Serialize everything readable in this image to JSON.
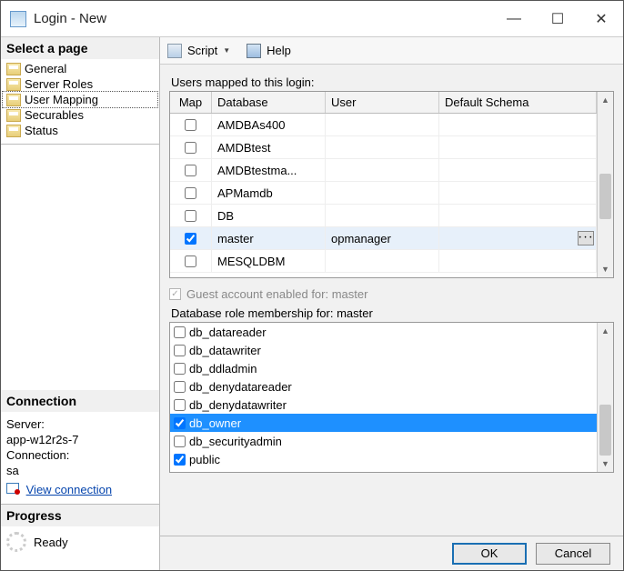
{
  "window": {
    "title": "Login - New"
  },
  "sidebar": {
    "heading": "Select a page",
    "pages": [
      "General",
      "Server Roles",
      "User Mapping",
      "Securables",
      "Status"
    ],
    "selected_index": 2
  },
  "connection": {
    "heading": "Connection",
    "server_label": "Server:",
    "server_value": "app-w12r2s-7",
    "conn_label": "Connection:",
    "conn_value": "sa",
    "view_link": "View connection"
  },
  "progress": {
    "heading": "Progress",
    "status": "Ready"
  },
  "toolbar": {
    "script": "Script",
    "help": "Help"
  },
  "users_section": {
    "label": "Users mapped to this login:",
    "columns": {
      "map": "Map",
      "db": "Database",
      "user": "User",
      "schema": "Default Schema"
    },
    "rows": [
      {
        "checked": false,
        "db": "AMDBAs400",
        "user": "",
        "schema": ""
      },
      {
        "checked": false,
        "db": "AMDBtest",
        "user": "",
        "schema": ""
      },
      {
        "checked": false,
        "db": "AMDBtestma...",
        "user": "",
        "schema": ""
      },
      {
        "checked": false,
        "db": "APMamdb",
        "user": "",
        "schema": ""
      },
      {
        "checked": false,
        "db": "DB",
        "user": "",
        "schema": ""
      },
      {
        "checked": true,
        "db": "master",
        "user": "opmanager",
        "schema": ""
      },
      {
        "checked": false,
        "db": "MESQLDBM",
        "user": "",
        "schema": ""
      }
    ],
    "selected_index": 5
  },
  "guest": {
    "label": "Guest account enabled for: master",
    "checked": true
  },
  "roles_section": {
    "label": "Database role membership for: master",
    "items": [
      {
        "name": "db_datareader",
        "checked": false
      },
      {
        "name": "db_datawriter",
        "checked": false
      },
      {
        "name": "db_ddladmin",
        "checked": false
      },
      {
        "name": "db_denydatareader",
        "checked": false
      },
      {
        "name": "db_denydatawriter",
        "checked": false
      },
      {
        "name": "db_owner",
        "checked": true
      },
      {
        "name": "db_securityadmin",
        "checked": false
      },
      {
        "name": "public",
        "checked": true
      }
    ],
    "selected_index": 5
  },
  "footer": {
    "ok": "OK",
    "cancel": "Cancel"
  }
}
